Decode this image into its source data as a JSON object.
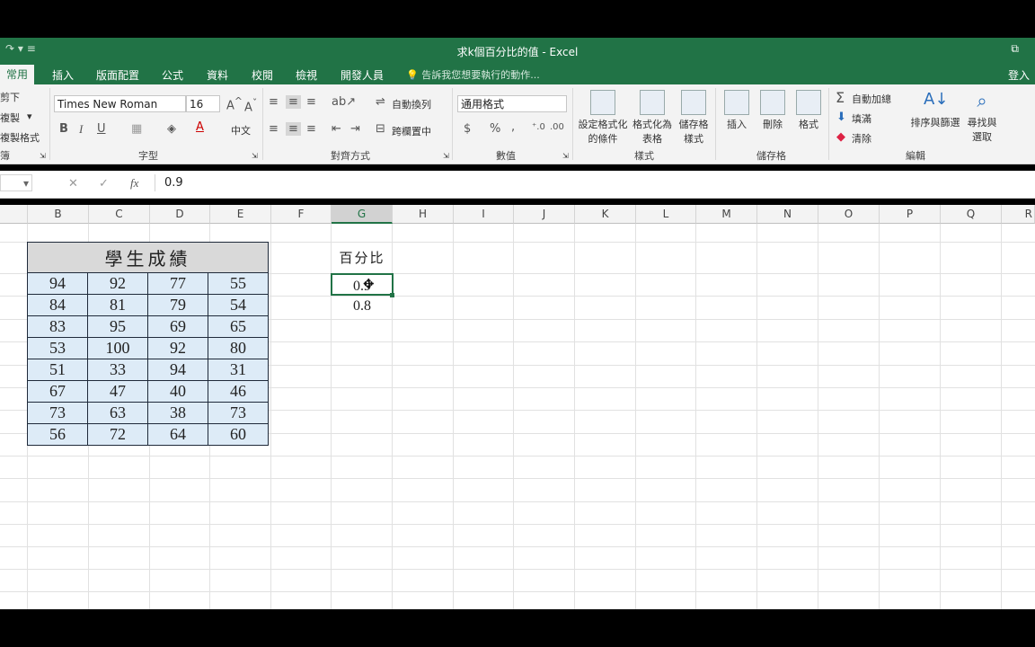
{
  "window": {
    "title": "求k個百分比的值 - Excel",
    "qat_icons": [
      "redo-icon",
      "customize-qat-icon"
    ],
    "restore_icon": "restore-window-icon"
  },
  "tabs": [
    "常用",
    "插入",
    "版面配置",
    "公式",
    "資料",
    "校閱",
    "檢視",
    "開發人員"
  ],
  "tell_me": "告訴我您想要執行的動作...",
  "login": "登入",
  "ribbon": {
    "clipboard": {
      "cut": "剪下",
      "copy": "複製",
      "format_painter": "複製格式",
      "group": "簿"
    },
    "font": {
      "name": "Times New Roman",
      "size": "16",
      "bold": "B",
      "italic": "I",
      "underline": "U",
      "group": "字型",
      "phonetic": "中文"
    },
    "alignment": {
      "wrap": "自動換列",
      "merge": "跨欄置中",
      "group": "對齊方式"
    },
    "number": {
      "format": "通用格式",
      "currency": "$",
      "percent": "%",
      "comma": ",",
      "group": "數值"
    },
    "styles": {
      "conditional": "設定格式化\n的條件",
      "as_table": "格式化為\n表格",
      "cell_styles": "儲存格\n樣式",
      "group": "樣式"
    },
    "cells": {
      "insert": "插入",
      "delete": "刪除",
      "format": "格式",
      "group": "儲存格"
    },
    "editing": {
      "autosum": "自動加總",
      "fill": "填滿",
      "clear": "清除",
      "sort": "排序與篩選",
      "find": "尋找與\n選取",
      "group": "編輯"
    }
  },
  "formula_bar": {
    "value": "0.9",
    "fx": "fx"
  },
  "columns": [
    "B",
    "C",
    "D",
    "E",
    "F",
    "G",
    "H",
    "I",
    "J",
    "K",
    "L",
    "M",
    "N",
    "O",
    "P",
    "Q",
    "R"
  ],
  "selected_column": "G",
  "table": {
    "title": "學生成績",
    "rows": [
      [
        "94",
        "92",
        "77",
        "55"
      ],
      [
        "84",
        "81",
        "79",
        "54"
      ],
      [
        "83",
        "95",
        "69",
        "65"
      ],
      [
        "53",
        "100",
        "92",
        "80"
      ],
      [
        "51",
        "33",
        "94",
        "31"
      ],
      [
        "67",
        "47",
        "40",
        "46"
      ],
      [
        "73",
        "63",
        "38",
        "73"
      ],
      [
        "56",
        "72",
        "64",
        "60"
      ]
    ]
  },
  "percent": {
    "header": "百分比",
    "values": [
      "0.9",
      "0.8"
    ]
  }
}
